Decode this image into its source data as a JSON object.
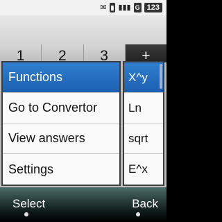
{
  "status": {
    "message_icon": "envelope-icon",
    "vibrate_icon": "vibrate-icon",
    "signal_icon": "signal-icon",
    "network_label": "G",
    "battery_label": "123"
  },
  "keypad": {
    "keys": [
      "1",
      "2",
      "3",
      "+"
    ]
  },
  "menu": {
    "items": [
      {
        "label": "Functions",
        "selected": true
      },
      {
        "label": "Go to Convertor"
      },
      {
        "label": "View answers"
      },
      {
        "label": "Settings"
      }
    ]
  },
  "functions_panel": {
    "items": [
      {
        "label": "X^y",
        "selected": true
      },
      {
        "label": "Ln"
      },
      {
        "label": "sqrt"
      },
      {
        "label": "E^x"
      }
    ]
  },
  "softkeys": {
    "left": "Select",
    "right": "Back"
  }
}
